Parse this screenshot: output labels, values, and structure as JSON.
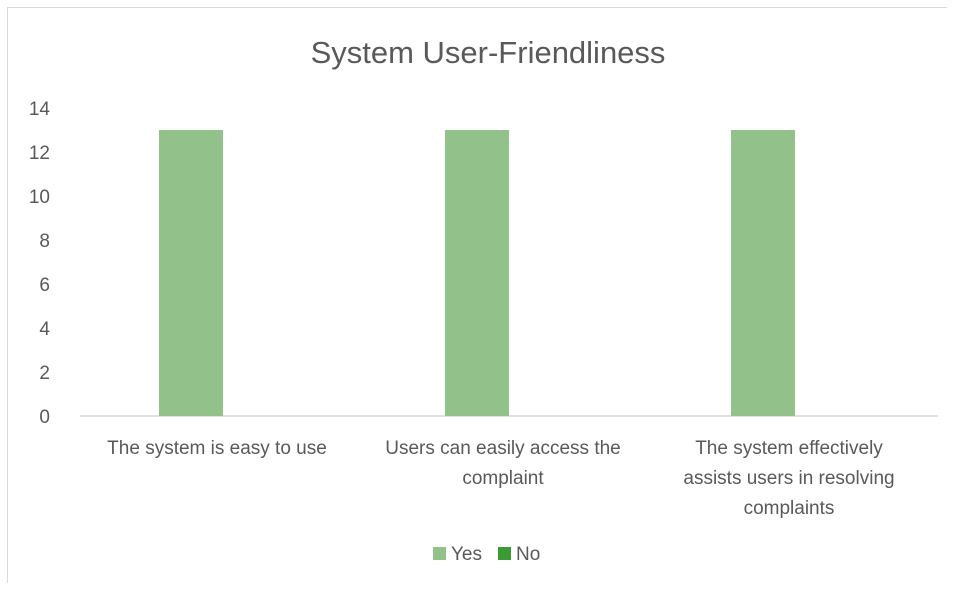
{
  "chart_data": {
    "type": "bar",
    "title": "System User-Friendliness",
    "categories": [
      [
        "The system is easy to use"
      ],
      [
        "Users can easily access the",
        "complaint"
      ],
      [
        "The system effectively",
        "assists users in resolving",
        "complaints"
      ]
    ],
    "series": [
      {
        "name": "Yes",
        "values": [
          13,
          13,
          13
        ],
        "color": "#93c18a"
      },
      {
        "name": "No",
        "values": [
          0,
          0,
          0
        ],
        "color": "#3a9a34"
      }
    ],
    "ylim": [
      0,
      14
    ],
    "yticks": [
      0,
      2,
      4,
      6,
      8,
      10,
      12,
      14
    ],
    "grid": false,
    "legend": "bottom"
  }
}
